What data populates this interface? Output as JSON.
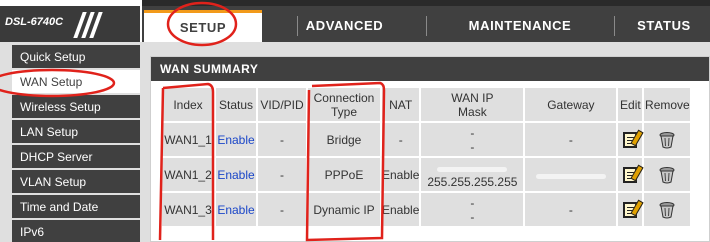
{
  "brand": {
    "model": "DSL-6740C"
  },
  "tabs": [
    {
      "label": "SETUP",
      "active": true
    },
    {
      "label": "ADVANCED",
      "active": false
    },
    {
      "label": "MAINTENANCE",
      "active": false
    },
    {
      "label": "STATUS",
      "active": false
    }
  ],
  "sidebar": {
    "items": [
      {
        "label": "Quick Setup"
      },
      {
        "label": "WAN Setup",
        "active": true
      },
      {
        "label": "Wireless Setup"
      },
      {
        "label": "LAN Setup"
      },
      {
        "label": "DHCP Server"
      },
      {
        "label": "VLAN Setup"
      },
      {
        "label": "Time and Date"
      },
      {
        "label": "IPv6"
      }
    ]
  },
  "summary": {
    "title": "WAN SUMMARY",
    "columns": [
      "Index",
      "Status",
      "VID/PID",
      "Connection Type",
      "NAT",
      "WAN IP Mask",
      "Gateway",
      "Edit",
      "Remove"
    ],
    "rows": [
      {
        "index": "WAN1_1",
        "status": "Enable",
        "vidpid": "-",
        "type": "Bridge",
        "nat": "-",
        "ip_line1": "-",
        "ip_line2": "-",
        "gateway": "-"
      },
      {
        "index": "WAN1_2",
        "status": "Enable",
        "vidpid": "-",
        "type": "PPPoE",
        "nat": "Enable",
        "ip_line1": "",
        "ip_line2": "255.255.255.255",
        "gateway": ""
      },
      {
        "index": "WAN1_3",
        "status": "Enable",
        "vidpid": "-",
        "type": "Dynamic IP",
        "nat": "Enable",
        "ip_line1": "-",
        "ip_line2": "-",
        "gateway": "-"
      }
    ]
  },
  "colors": {
    "accent": "#f29a1a",
    "nav_bg": "#404040",
    "link": "#1a46c8",
    "annotation": "#e0221b"
  },
  "icons": {
    "edit": "edit-icon",
    "remove": "trash-icon"
  }
}
